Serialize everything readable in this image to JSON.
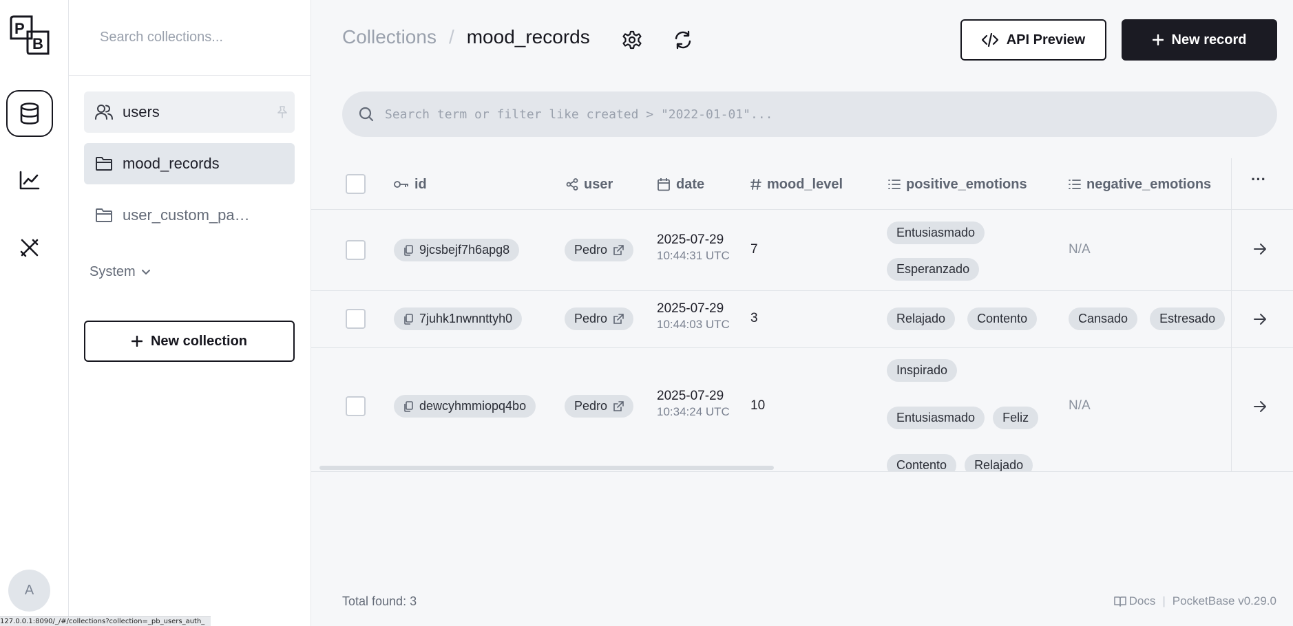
{
  "rail": {
    "logo_letters": [
      "P",
      "B"
    ],
    "avatar_letter": "A",
    "items": [
      {
        "name": "collections",
        "icon": "database-icon",
        "active": true
      },
      {
        "name": "logs",
        "icon": "chart-line-icon",
        "active": false
      },
      {
        "name": "settings",
        "icon": "tools-icon",
        "active": false
      }
    ]
  },
  "sidebar": {
    "search_placeholder": "Search collections...",
    "collections": [
      {
        "label": "users",
        "icon": "users-icon",
        "pinned": true
      },
      {
        "label": "mood_records",
        "icon": "folder-icon",
        "active": true
      },
      {
        "label": "user_custom_pa…",
        "icon": "folder-icon"
      }
    ],
    "system_label": "System",
    "new_collection_label": "New collection"
  },
  "header": {
    "crumb_root": "Collections",
    "crumb_separator": "/",
    "crumb_current": "mood_records",
    "api_preview_label": "API Preview",
    "new_record_label": "New record"
  },
  "search": {
    "placeholder": "Search term or filter like created > \"2022-01-01\"..."
  },
  "table": {
    "columns": [
      {
        "label": "id",
        "icon": "key-icon"
      },
      {
        "label": "user",
        "icon": "relation-icon"
      },
      {
        "label": "date",
        "icon": "calendar-icon"
      },
      {
        "label": "mood_level",
        "icon": "hash-icon"
      },
      {
        "label": "positive_emotions",
        "icon": "list-icon"
      },
      {
        "label": "negative_emotions",
        "icon": "list-icon"
      }
    ],
    "more_label": "···",
    "rows": [
      {
        "id": "9jcsbejf7h6apg8",
        "user": "Pedro",
        "date": "2025-07-29",
        "time": "10:44:31 UTC",
        "mood_level": "7",
        "positive": [
          "Entusiasmado",
          "Esperanzado"
        ],
        "negative_text": "N/A",
        "negative": []
      },
      {
        "id": "7juhk1nwnnttyh0",
        "user": "Pedro",
        "date": "2025-07-29",
        "time": "10:44:03 UTC",
        "mood_level": "3",
        "positive": [
          "Relajado",
          "Contento"
        ],
        "negative_text": "",
        "negative": [
          "Cansado",
          "Estresado"
        ]
      },
      {
        "id": "dewcyhmmiopq4bo",
        "user": "Pedro",
        "date": "2025-07-29",
        "time": "10:34:24 UTC",
        "mood_level": "10",
        "positive": [
          "Inspirado",
          "Entusiasmado",
          "Feliz",
          "Contento",
          "Relajado"
        ],
        "negative_text": "N/A",
        "negative": []
      }
    ]
  },
  "footer": {
    "total_label": "Total found:",
    "total_value": "3",
    "docs_label": "Docs",
    "version": "PocketBase v0.29.0"
  },
  "statusbar": {
    "url": "127.0.0.1:8090/_/#/collections?collection=_pb_users_auth_"
  },
  "colors": {
    "accent_dark": "#1b1b23",
    "chip_bg": "#dee2e7",
    "page_bg": "#f6f7f9"
  }
}
